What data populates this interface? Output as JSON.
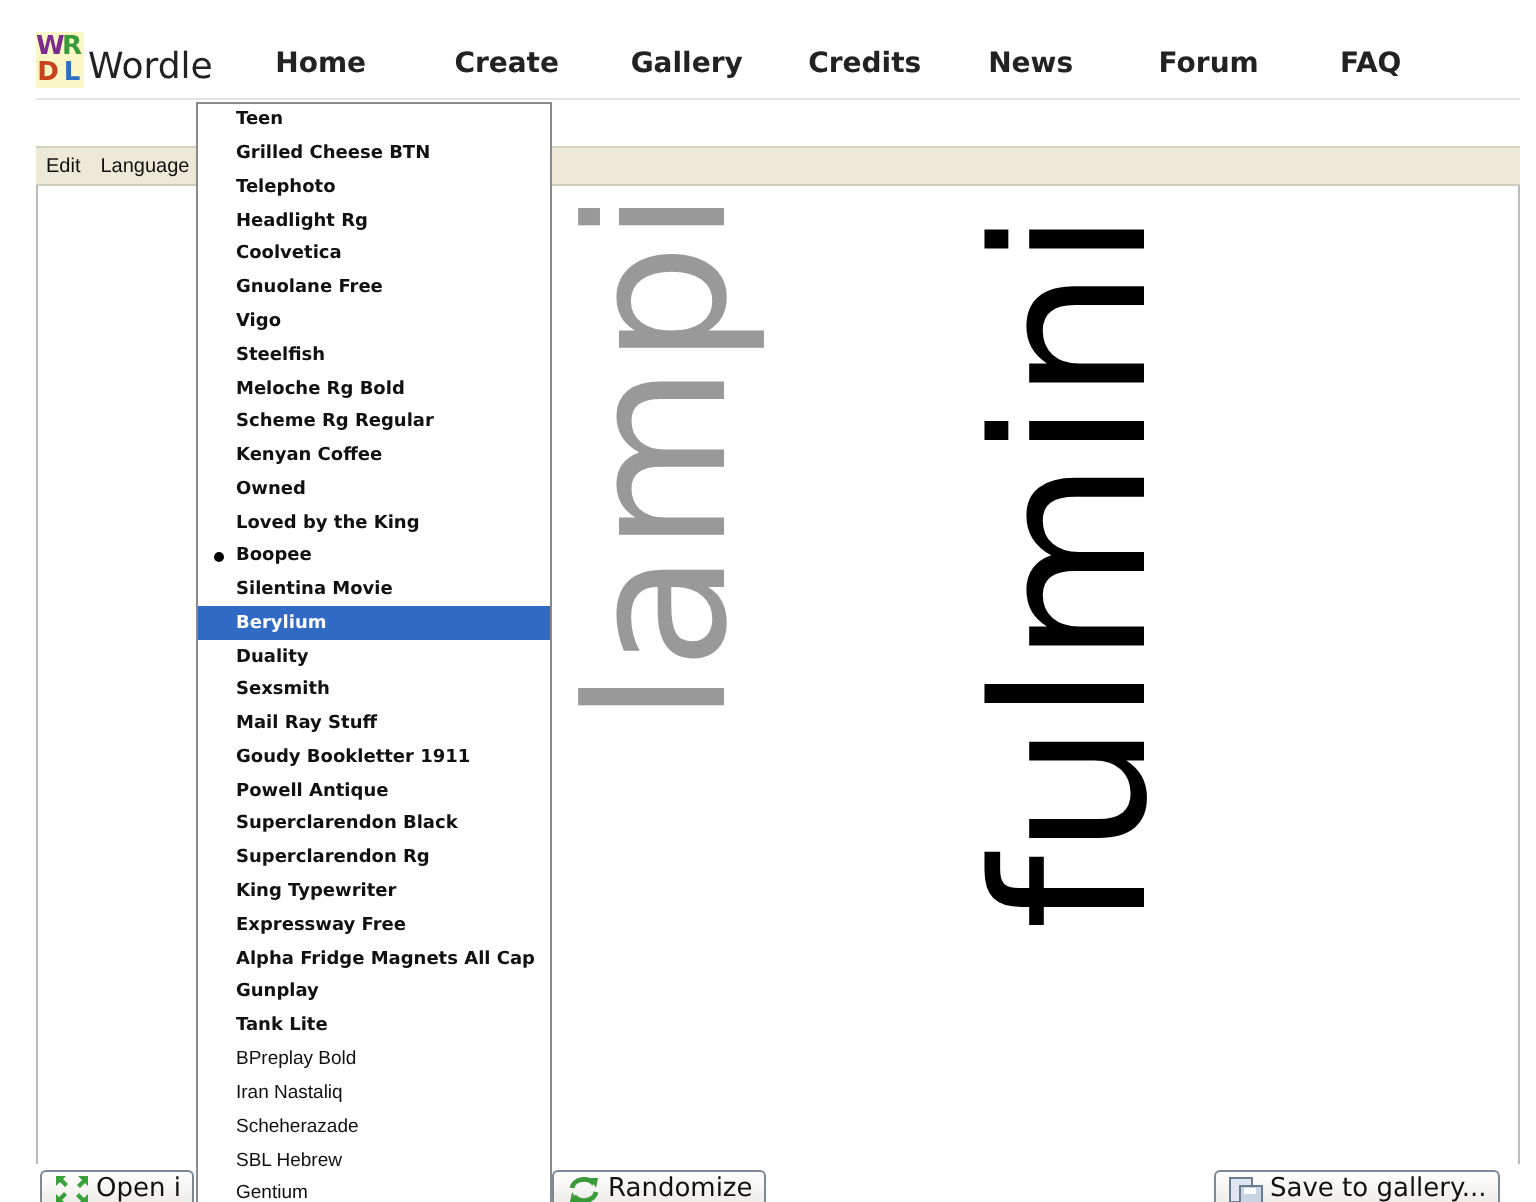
{
  "logo": {
    "letters": [
      {
        "char": "W",
        "color": "#7b2d8e"
      },
      {
        "char": "R",
        "color": "#3a9a3a"
      },
      {
        "char": "D",
        "color": "#c8421e"
      },
      {
        "char": "L",
        "color": "#2a6fc0"
      }
    ],
    "name": "Wordle"
  },
  "nav": [
    "Home",
    "Create",
    "Gallery",
    "Credits",
    "News",
    "Forum",
    "FAQ"
  ],
  "menu_bar": [
    {
      "label": "Edit"
    },
    {
      "label": "Language"
    }
  ],
  "canvas": {
    "words": [
      {
        "text": "lampi",
        "color": "#999999"
      },
      {
        "text": "fulmini",
        "color": "#000000"
      }
    ]
  },
  "font_menu": {
    "items": [
      {
        "label": "Teen",
        "kind": "bold",
        "checked": false,
        "selected": false
      },
      {
        "label": "Grilled Cheese BTN",
        "kind": "bold",
        "checked": false,
        "selected": false
      },
      {
        "label": "Telephoto",
        "kind": "bold",
        "checked": false,
        "selected": false
      },
      {
        "label": "Headlight Rg",
        "kind": "bold",
        "checked": false,
        "selected": false
      },
      {
        "label": "Coolvetica",
        "kind": "bold",
        "checked": false,
        "selected": false
      },
      {
        "label": "Gnuolane Free",
        "kind": "bold",
        "checked": false,
        "selected": false
      },
      {
        "label": "Vigo",
        "kind": "bold",
        "checked": false,
        "selected": false
      },
      {
        "label": "Steelfish",
        "kind": "bold",
        "checked": false,
        "selected": false
      },
      {
        "label": "Meloche Rg Bold",
        "kind": "bold",
        "checked": false,
        "selected": false
      },
      {
        "label": "Scheme Rg Regular",
        "kind": "bold",
        "checked": false,
        "selected": false
      },
      {
        "label": "Kenyan Coffee",
        "kind": "bold",
        "checked": false,
        "selected": false
      },
      {
        "label": "Owned",
        "kind": "bold",
        "checked": false,
        "selected": false
      },
      {
        "label": "Loved by the King",
        "kind": "bold",
        "checked": false,
        "selected": false
      },
      {
        "label": "Boopee",
        "kind": "bold",
        "checked": true,
        "selected": false
      },
      {
        "label": "Silentina Movie",
        "kind": "bold",
        "checked": false,
        "selected": false
      },
      {
        "label": "Berylium",
        "kind": "bold",
        "checked": false,
        "selected": true
      },
      {
        "label": "Duality",
        "kind": "bold",
        "checked": false,
        "selected": false
      },
      {
        "label": "Sexsmith",
        "kind": "bold",
        "checked": false,
        "selected": false
      },
      {
        "label": "Mail Ray Stuff",
        "kind": "bold",
        "checked": false,
        "selected": false
      },
      {
        "label": "Goudy Bookletter 1911",
        "kind": "bold",
        "checked": false,
        "selected": false
      },
      {
        "label": "Powell Antique",
        "kind": "bold",
        "checked": false,
        "selected": false
      },
      {
        "label": "Superclarendon Black",
        "kind": "bold",
        "checked": false,
        "selected": false
      },
      {
        "label": "Superclarendon Rg",
        "kind": "bold",
        "checked": false,
        "selected": false
      },
      {
        "label": "King Typewriter",
        "kind": "bold",
        "checked": false,
        "selected": false
      },
      {
        "label": "Expressway Free",
        "kind": "bold",
        "checked": false,
        "selected": false
      },
      {
        "label": "Alpha Fridge Magnets All Cap",
        "kind": "bold",
        "checked": false,
        "selected": false
      },
      {
        "label": "Gunplay",
        "kind": "bold",
        "checked": false,
        "selected": false
      },
      {
        "label": "Tank Lite",
        "kind": "bold",
        "checked": false,
        "selected": false
      },
      {
        "label": "BPreplay Bold",
        "kind": "plain",
        "checked": false,
        "selected": false
      },
      {
        "label": "Iran Nastaliq",
        "kind": "plain",
        "checked": false,
        "selected": false
      },
      {
        "label": "Scheherazade",
        "kind": "plain",
        "checked": false,
        "selected": false
      },
      {
        "label": "SBL Hebrew",
        "kind": "plain",
        "checked": false,
        "selected": false
      },
      {
        "label": "Gentium",
        "kind": "plain",
        "checked": false,
        "selected": false
      }
    ]
  },
  "buttons": [
    {
      "label": "Open i",
      "kind": "open"
    },
    {
      "label": "Randomize",
      "kind": "randomize"
    },
    {
      "label": "Save to gallery...",
      "kind": "save"
    }
  ]
}
